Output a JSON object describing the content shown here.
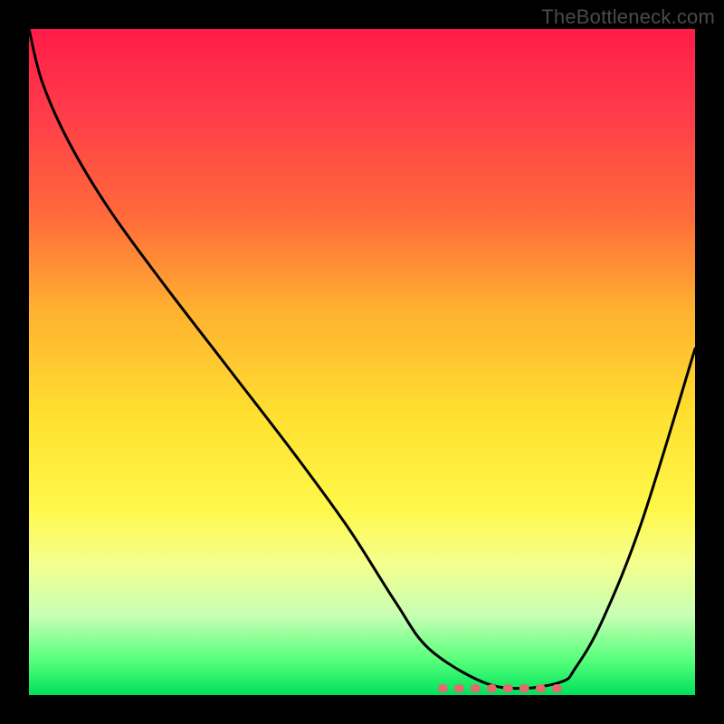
{
  "watermark": "TheBottleneck.com",
  "chart_data": {
    "type": "line",
    "note": "Stylized bottleneck curve over a red→green vertical gradient. Axes are unlabeled; y implicitly 0–100% bottleneck, x is a configuration sweep 0–1. Values are estimated from the rendered curve path.",
    "title": "",
    "xlabel": "",
    "ylabel": "",
    "xlim": [
      0,
      1
    ],
    "ylim": [
      0,
      100
    ],
    "x": [
      0.0,
      0.02,
      0.06,
      0.12,
      0.2,
      0.3,
      0.4,
      0.48,
      0.55,
      0.6,
      0.68,
      0.74,
      0.8,
      0.82,
      0.86,
      0.92,
      1.0
    ],
    "series": [
      {
        "name": "bottleneck-curve",
        "values": [
          100,
          92,
          83,
          73,
          62,
          49,
          36,
          25,
          14,
          7,
          2,
          1,
          2,
          4,
          11,
          26,
          52
        ]
      }
    ],
    "flat_region": {
      "x_start": 0.62,
      "x_end": 0.8,
      "color": "#e46a6e"
    }
  }
}
